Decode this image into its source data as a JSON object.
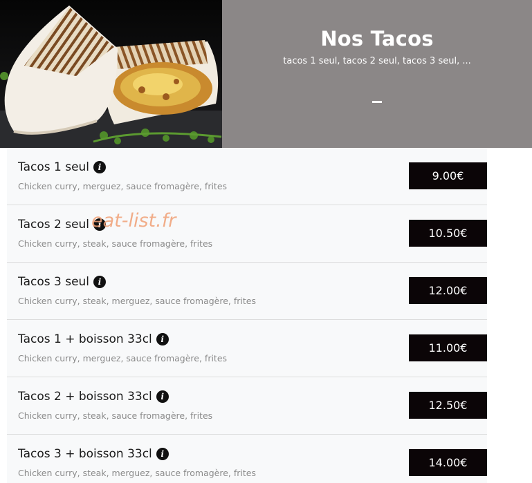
{
  "header": {
    "title": "Nos Tacos",
    "subtitle": "tacos 1 seul, tacos 2 seul, tacos 3 seul, ...",
    "panel_color": "#8b8787"
  },
  "watermark": "eat-list.fr",
  "menu": {
    "items": [
      {
        "name": "Tacos 1 seul",
        "description": "Chicken curry, merguez, sauce fromagère, frites",
        "price": "9.00€",
        "icon": "info-icon"
      },
      {
        "name": "Tacos 2 seul",
        "description": "Chicken curry, steak, sauce fromagère, frites",
        "price": "10.50€",
        "icon": "info-icon"
      },
      {
        "name": "Tacos 3 seul",
        "description": "Chicken curry, steak, merguez, sauce fromagère, frites",
        "price": "12.00€",
        "icon": "info-icon"
      },
      {
        "name": "Tacos 1 + boisson 33cl",
        "description": "Chicken curry, merguez, sauce fromagère, frites",
        "price": "11.00€",
        "icon": "info-icon"
      },
      {
        "name": "Tacos 2 + boisson 33cl",
        "description": "Chicken curry, steak, sauce fromagère, frites",
        "price": "12.50€",
        "icon": "info-icon"
      },
      {
        "name": "Tacos 3 + boisson 33cl",
        "description": "Chicken curry, steak, merguez, sauce fromagère, frites",
        "price": "14.00€",
        "icon": "info-icon"
      }
    ]
  },
  "colors": {
    "price_background": "#0b0507",
    "list_background": "#f8f9fa",
    "description_text": "#8a8a8a"
  }
}
